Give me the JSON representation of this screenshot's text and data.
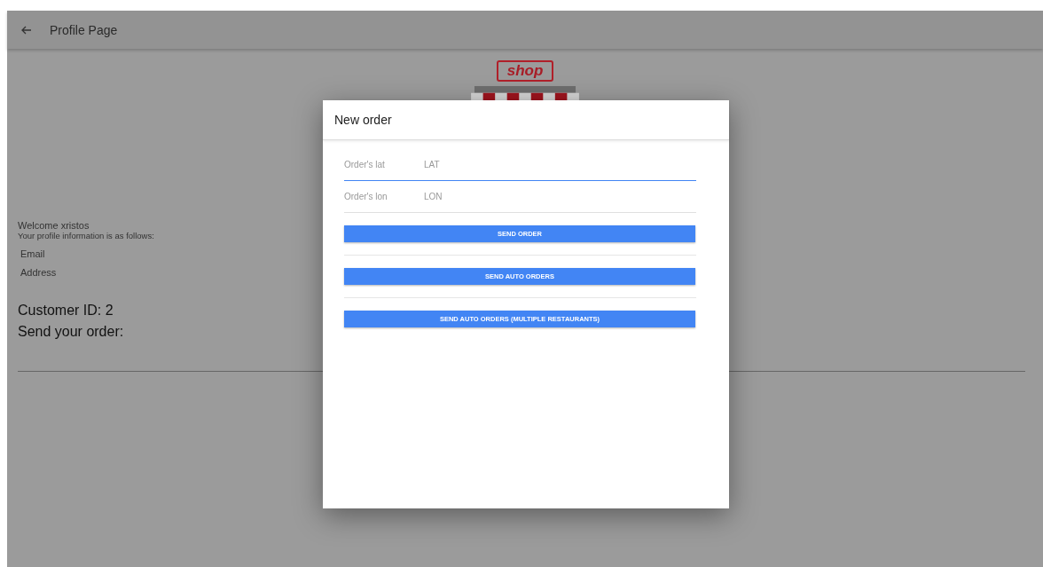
{
  "app_bar": {
    "title": "Profile Page"
  },
  "logo": {
    "text": "shop"
  },
  "profile": {
    "welcome": "Welcome xristos",
    "intro": "Your profile information is as follows:",
    "fields": [
      "Email",
      "Address"
    ]
  },
  "customer_id": "Customer ID: 2",
  "send_heading": "Send your order:",
  "dialog": {
    "title": "New order",
    "fields": [
      {
        "label": "Order's lat",
        "placeholder": "LAT",
        "focused": true
      },
      {
        "label": "Order's lon",
        "placeholder": "LON",
        "focused": false
      }
    ],
    "buttons": [
      "SEND ORDER",
      "SEND AUTO ORDERS",
      "SEND AUTO ORDERS (MULTIPLE RESTAURANTS)"
    ]
  }
}
